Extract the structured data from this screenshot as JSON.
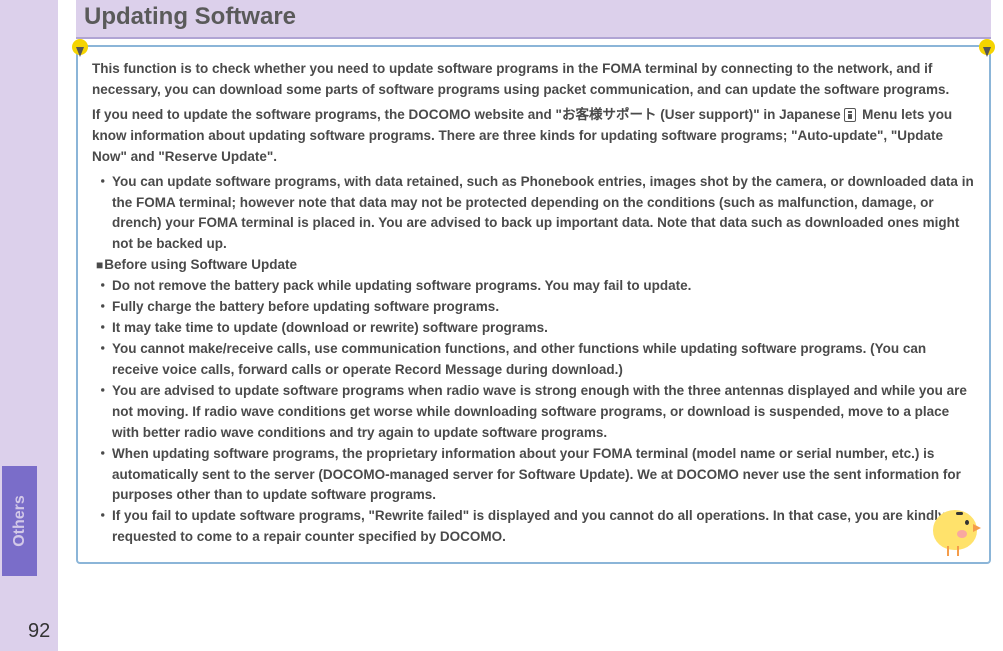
{
  "sidebar": {
    "tab_label": "Others"
  },
  "page_number": "92",
  "title": "Updating Software",
  "intro": {
    "p1": "This function is to check whether you need to update software programs in the FOMA terminal by connecting to the network, and if necessary, you can download some parts of software programs using packet communication, and can update the software programs.",
    "p2a": "If you need to update the software programs, the DOCOMO website and \"お客様サポート (User support)\" in Japanese",
    "p2b": " Menu lets you know information about updating software programs. There are three kinds for updating software programs; \"Auto-update\", \"Update Now\" and \"Reserve Update\"."
  },
  "bullets_top": [
    "You can update software programs, with data retained, such as Phonebook entries, images shot by the camera, or downloaded data in the FOMA terminal; however note that data may not be protected depending on the conditions (such as malfunction, damage, or drench) your FOMA terminal is placed in. You are advised to back up important data. Note that data such as downloaded ones might not be backed up."
  ],
  "section_heading": "Before using Software Update",
  "bullets_before": [
    "Do not remove the battery pack while updating software programs. You may fail to update.",
    "Fully charge the battery before updating software programs.",
    "It may take time to update (download or rewrite) software programs.",
    "You cannot make/receive calls, use communication functions, and other functions while updating software programs. (You can receive voice calls, forward calls or operate Record Message during download.)",
    "You are advised to update software programs when radio wave is strong enough with the three antennas displayed and while you are not moving. If radio wave conditions get worse while downloading software programs, or download is suspended, move to a place with better radio wave conditions and try again to update software programs.",
    "When updating software programs, the proprietary information about your FOMA terminal (model name or serial number, etc.) is automatically sent to the server (DOCOMO-managed server for Software Update). We at DOCOMO never use the sent information for purposes other than to update software programs.",
    "If you fail to update software programs, \"Rewrite failed\" is displayed and you cannot do all operations. In that case, you are kindly requested to come to a repair counter specified by DOCOMO."
  ]
}
